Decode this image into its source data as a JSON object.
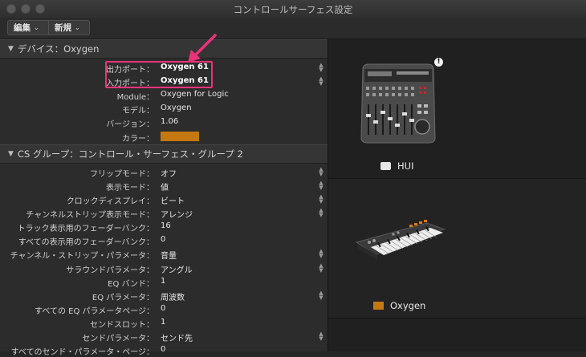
{
  "window": {
    "title": "コントロールサーフェス設定"
  },
  "toolbar": {
    "edit_label": "編集",
    "new_label": "新規"
  },
  "device_section": {
    "header": "デバイス：Oxygen",
    "rows": [
      {
        "label": "出力ポート：",
        "value": "Oxygen 61"
      },
      {
        "label": "入力ポート：",
        "value": "Oxygen 61"
      },
      {
        "label": "Module：",
        "value": "Oxygen for Logic"
      },
      {
        "label": "モデル：",
        "value": "Oxygen"
      },
      {
        "label": "バージョン：",
        "value": "1.06"
      },
      {
        "label": "カラー：",
        "value": ""
      }
    ],
    "color": "#c47810"
  },
  "group_section": {
    "header": "CS グループ：コントロール・サーフェス・グループ 2",
    "rows": [
      {
        "label": "フリップモード：",
        "value": "オフ"
      },
      {
        "label": "表示モード：",
        "value": "値"
      },
      {
        "label": "クロックディスプレイ：",
        "value": "ビート"
      },
      {
        "label": "チャンネルストリップ表示モード：",
        "value": "アレンジ"
      },
      {
        "label": "トラック表示用のフェーダーバンク：",
        "value": "16"
      },
      {
        "label": "すべての表示用のフェーダーバンク：",
        "value": "0"
      },
      {
        "label": "チャンネル・ストリップ・パラメータ：",
        "value": "音量"
      },
      {
        "label": "サラウンドパラメータ：",
        "value": "アングル"
      },
      {
        "label": "EQ バンド：",
        "value": "1"
      },
      {
        "label": "EQ パラメータ：",
        "value": "周波数"
      },
      {
        "label": "すべての EQ パラメータページ：",
        "value": "0"
      },
      {
        "label": "センドスロット：",
        "value": "1"
      },
      {
        "label": "センドパラメータ：",
        "value": "センド先"
      },
      {
        "label": "すべてのセンド・パラメータ・ページ：",
        "value": "0"
      }
    ]
  },
  "devices": [
    {
      "name": "HUI",
      "swatch_color": "#e6e6e6",
      "icon": "hui-controller-icon"
    },
    {
      "name": "Oxygen",
      "swatch_color": "#c47810",
      "icon": "oxygen-keyboard-icon"
    }
  ],
  "annotation": {
    "color": "#e8337a"
  }
}
